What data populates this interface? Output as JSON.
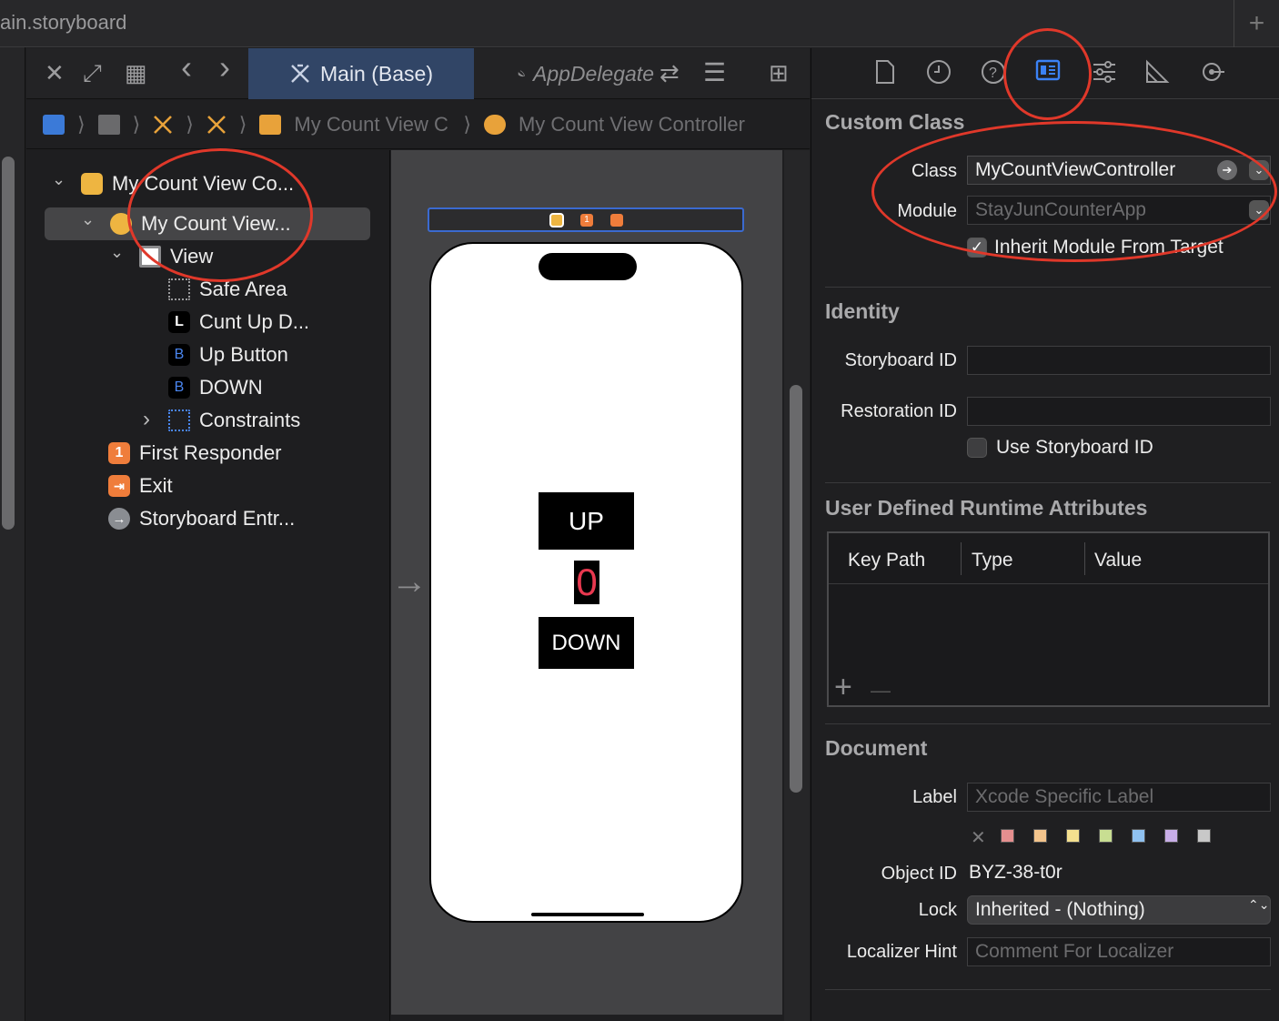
{
  "titlebar": {
    "filename": "ain.storyboard",
    "add_icon": "+"
  },
  "editor_toolbar": {
    "close_icon": "✕",
    "expand_icon": "⤢",
    "grid_icon": "▦",
    "back_icon": "‹",
    "forward_icon": "›",
    "main_tab_label": "Main (Base)",
    "appdelegate_tab_label": "AppDelegate",
    "swap_icon": "⇄",
    "lines_icon": "☰",
    "add_editor_icon": "⊞"
  },
  "breadcrumb": {
    "sep": "⟩",
    "scene_label": "My Count View C",
    "controller_label": "My Count View Controller"
  },
  "outline": {
    "scene": "My Count View Co...",
    "controller": "My Count View...",
    "view": "View",
    "safe_area": "Safe Area",
    "label_item": "Cunt Up D...",
    "label_badge": "L",
    "up_button": "Up Button",
    "button_badge": "B",
    "down_button": "DOWN",
    "constraints": "Constraints",
    "first_responder": "First Responder",
    "first_responder_badge": "1",
    "exit": "Exit",
    "entry": "Storyboard Entr...",
    "entry_icon": "→",
    "chev_down": "⌄",
    "chev_right": "›"
  },
  "canvas": {
    "up_label": "UP",
    "count_label": "0",
    "down_label": "DOWN",
    "entry_arrow": "→",
    "scene_badge_first": "1"
  },
  "inspector": {
    "custom_class_header": "Custom Class",
    "class_label": "Class",
    "class_value": "MyCountViewController",
    "module_label": "Module",
    "module_placeholder": "StayJunCounterApp",
    "inherit_label": "Inherit Module From Target",
    "identity_header": "Identity",
    "storyboard_id_label": "Storyboard ID",
    "restoration_id_label": "Restoration ID",
    "use_storyboard_id_label": "Use Storyboard ID",
    "udra_header": "User Defined Runtime Attributes",
    "col_key_path": "Key Path",
    "col_type": "Type",
    "col_value": "Value",
    "add_icon": "+",
    "remove_icon": "—",
    "document_header": "Document",
    "doc_label_label": "Label",
    "doc_label_placeholder": "Xcode Specific Label",
    "object_id_label": "Object ID",
    "object_id_value": "BYZ-38-t0r",
    "lock_label": "Lock",
    "lock_value": "Inherited - (Nothing)",
    "localizer_label": "Localizer Hint",
    "localizer_placeholder": "Comment For Localizer",
    "clear_color_icon": "✕",
    "checkmark": "✓",
    "arrow_icon": "➔",
    "chevron_icon": "⌄",
    "updown_icon": "⌃⌄"
  },
  "colors": {
    "accent": "#3b82f6",
    "annotation_red": "#e0382a",
    "tab_selected": "#314566",
    "count_text": "#e8384f",
    "label_swatches": [
      "#e58f8f",
      "#f3c48c",
      "#f4e08f",
      "#c8de92",
      "#8fc1f0",
      "#c8aee8",
      "#c8c8c8"
    ]
  }
}
